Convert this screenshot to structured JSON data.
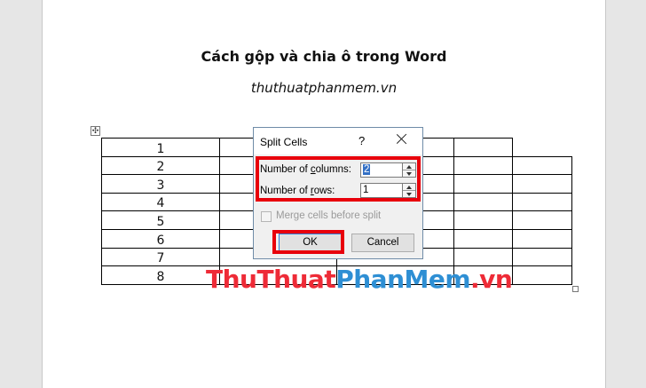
{
  "document": {
    "title": "Cách gộp và chia ô trong Word",
    "subtitle": "thuthuatphanmem.vn",
    "move_handle_glyph": "✣",
    "table_rows": [
      [
        "1",
        "",
        "",
        "",
        "",
        ""
      ],
      [
        "2",
        "",
        "",
        "",
        ""
      ],
      [
        "3",
        "",
        "",
        "",
        ""
      ],
      [
        "4",
        "",
        "",
        "",
        ""
      ],
      [
        "5",
        "",
        "",
        "",
        ""
      ],
      [
        "6",
        "",
        "",
        "",
        ""
      ],
      [
        "7",
        "",
        "",
        "",
        ""
      ],
      [
        "8",
        "",
        "",
        "",
        ""
      ]
    ]
  },
  "watermark": {
    "part1": "ThuThuat",
    "part2": "PhanMem",
    "part3": ".vn"
  },
  "dialog": {
    "title": "Split Cells",
    "help_glyph": "?",
    "columns_label_pre": "Number of ",
    "columns_label_key": "c",
    "columns_label_post": "olumns:",
    "columns_value": "2",
    "rows_label_pre": "Number of ",
    "rows_label_key": "r",
    "rows_label_post": "ows:",
    "rows_value": "1",
    "merge_label": "Merge cells before split",
    "ok_label": "OK",
    "cancel_label": "Cancel"
  },
  "colors": {
    "highlight": "#e8000b",
    "watermark_red": "#ee2b37",
    "watermark_blue": "#2e8fd4",
    "selection": "#3370c5"
  },
  "icons": [
    "table-move-icon",
    "close-icon",
    "spin-up-icon",
    "spin-down-icon",
    "table-resize-icon"
  ]
}
